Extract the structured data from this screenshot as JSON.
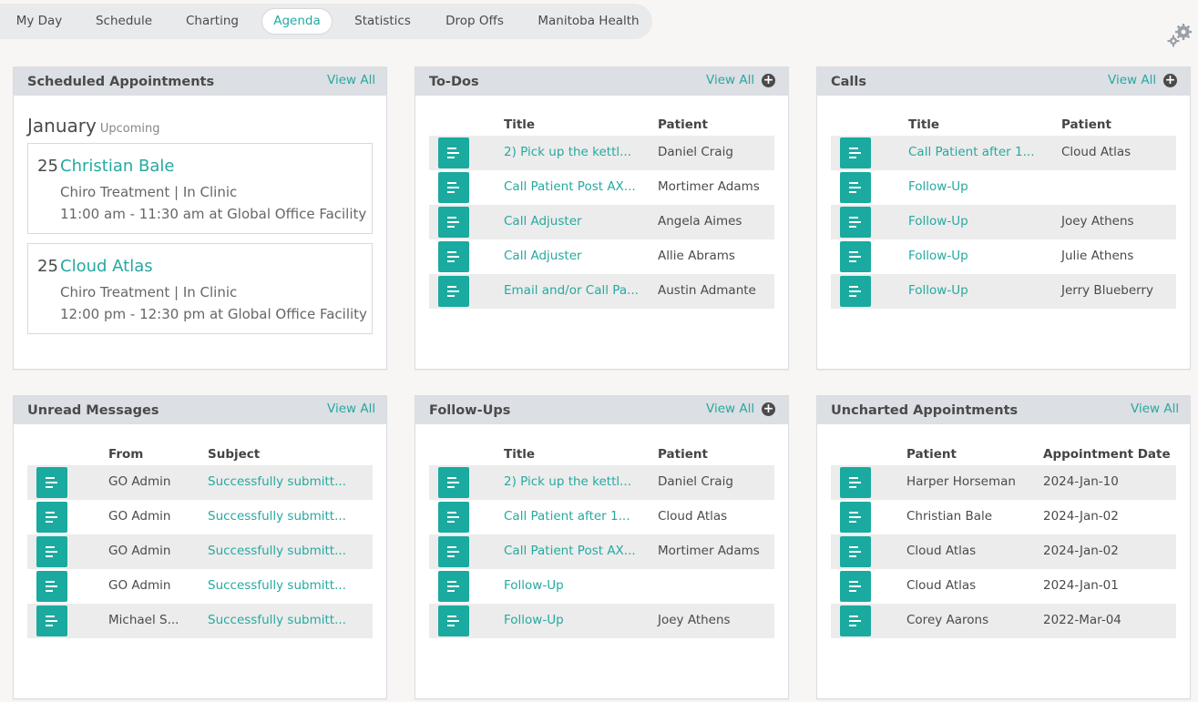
{
  "nav": {
    "tabs": [
      "My Day",
      "Schedule",
      "Charting",
      "Agenda",
      "Statistics",
      "Drop Offs",
      "Manitoba Health"
    ],
    "active": "Agenda"
  },
  "scheduled": {
    "title": "Scheduled Appointments",
    "view_all": "View All",
    "month": "January",
    "upcoming": "Upcoming",
    "appointments": [
      {
        "day": "25",
        "name": "Christian Bale",
        "type": "Chiro Treatment | In Clinic",
        "time": "11:00 am - 11:30 am at Global Office Facility"
      },
      {
        "day": "25",
        "name": "Cloud Atlas",
        "type": "Chiro Treatment | In Clinic",
        "time": "12:00 pm - 12:30 pm at Global Office Facility"
      }
    ]
  },
  "todos": {
    "title": "To-Dos",
    "view_all": "View All",
    "columns": [
      "Title",
      "Patient"
    ],
    "rows": [
      {
        "title": "2) Pick up the kettl...",
        "patient": "Daniel Craig"
      },
      {
        "title": "Call Patient Post AX...",
        "patient": "Mortimer Adams"
      },
      {
        "title": "Call Adjuster",
        "patient": "Angela Aimes"
      },
      {
        "title": "Call Adjuster",
        "patient": "Allie Abrams"
      },
      {
        "title": "Email and/or Call Pa...",
        "patient": "Austin Admante"
      }
    ]
  },
  "calls": {
    "title": "Calls",
    "view_all": "View All",
    "columns": [
      "Title",
      "Patient"
    ],
    "rows": [
      {
        "title": "Call Patient after 1...",
        "patient": "Cloud Atlas"
      },
      {
        "title": "Follow-Up",
        "patient": ""
      },
      {
        "title": "Follow-Up",
        "patient": "Joey Athens"
      },
      {
        "title": "Follow-Up",
        "patient": "Julie Athens"
      },
      {
        "title": "Follow-Up",
        "patient": "Jerry Blueberry"
      }
    ]
  },
  "messages": {
    "title": "Unread Messages",
    "view_all": "View All",
    "columns": [
      "From",
      "Subject"
    ],
    "rows": [
      {
        "from": "GO Admin",
        "subject": "Successfully submitt..."
      },
      {
        "from": "GO Admin",
        "subject": "Successfully submitt..."
      },
      {
        "from": "GO Admin",
        "subject": "Successfully submitt..."
      },
      {
        "from": "GO Admin",
        "subject": "Successfully submitt..."
      },
      {
        "from": "Michael S...",
        "subject": "Successfully submitt..."
      }
    ]
  },
  "followups": {
    "title": "Follow-Ups",
    "view_all": "View All",
    "columns": [
      "Title",
      "Patient"
    ],
    "rows": [
      {
        "title": "2) Pick up the kettl...",
        "patient": "Daniel Craig"
      },
      {
        "title": "Call Patient after 1...",
        "patient": "Cloud Atlas"
      },
      {
        "title": "Call Patient Post AX...",
        "patient": "Mortimer Adams"
      },
      {
        "title": "Follow-Up",
        "patient": ""
      },
      {
        "title": "Follow-Up",
        "patient": "Joey Athens"
      }
    ]
  },
  "uncharted": {
    "title": "Uncharted Appointments",
    "view_all": "View All",
    "columns": [
      "Patient",
      "Appointment Date"
    ],
    "rows": [
      {
        "patient": "Harper Horseman",
        "date": "2024-Jan-10"
      },
      {
        "patient": "Christian Bale",
        "date": "2024-Jan-02"
      },
      {
        "patient": "Cloud Atlas",
        "date": "2024-Jan-02"
      },
      {
        "patient": "Cloud Atlas",
        "date": "2024-Jan-01"
      },
      {
        "patient": "Corey Aarons",
        "date": "2022-Mar-04"
      }
    ]
  },
  "icons": {
    "settings": "gears-icon",
    "add": "plus-circle-icon",
    "row_action": "document-lines-icon"
  },
  "colors": {
    "accent": "#26a9a0",
    "button": "#1aaa9f",
    "header_bg": "#dcdfe3"
  }
}
